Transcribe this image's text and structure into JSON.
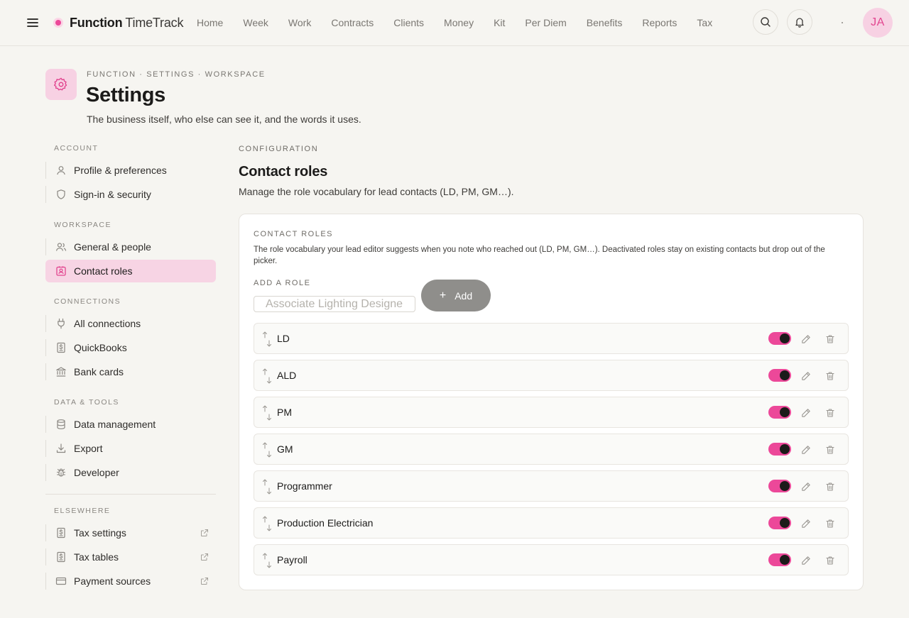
{
  "app": {
    "brand_name": "Function",
    "brand_sub": "TimeTrack",
    "nav": [
      "Home",
      "Week",
      "Work",
      "Contracts",
      "Clients",
      "Money",
      "Kit",
      "Per Diem",
      "Benefits",
      "Reports",
      "Tax"
    ],
    "user_initials": "JA",
    "accent_color": "#ec4899",
    "icons": {
      "menu": "hamburger-icon",
      "search": "search-icon",
      "notifications": "bell-icon"
    }
  },
  "header": {
    "breadcrumb": "FUNCTION · SETTINGS · WORKSPACE",
    "title": "Settings",
    "subtitle": "The business itself, who else can see it, and the words it uses.",
    "icon": "gear-icon"
  },
  "sidebar": {
    "groups": [
      {
        "label": "ACCOUNT",
        "items": [
          {
            "label": "Profile & preferences",
            "icon": "user-icon"
          },
          {
            "label": "Sign-in & security",
            "icon": "shield-icon"
          }
        ]
      },
      {
        "label": "WORKSPACE",
        "items": [
          {
            "label": "General & people",
            "icon": "users-icon"
          },
          {
            "label": "Contact roles",
            "icon": "contact-card-icon",
            "active": true
          }
        ]
      },
      {
        "label": "CONNECTIONS",
        "items": [
          {
            "label": "All connections",
            "icon": "plug-icon"
          },
          {
            "label": "QuickBooks",
            "icon": "dollar-doc-icon"
          },
          {
            "label": "Bank cards",
            "icon": "bank-icon"
          }
        ]
      },
      {
        "label": "DATA & TOOLS",
        "items": [
          {
            "label": "Data management",
            "icon": "database-icon"
          },
          {
            "label": "Export",
            "icon": "download-icon"
          },
          {
            "label": "Developer",
            "icon": "bug-icon"
          }
        ]
      },
      {
        "label": "ELSEWHERE",
        "items": [
          {
            "label": "Tax settings",
            "icon": "dollar-doc-icon",
            "external": true
          },
          {
            "label": "Tax tables",
            "icon": "dollar-doc-icon",
            "external": true
          },
          {
            "label": "Payment sources",
            "icon": "credit-card-icon",
            "external": true
          }
        ]
      }
    ]
  },
  "main": {
    "eyebrow": "CONFIGURATION",
    "title": "Contact roles",
    "description": "Manage the role vocabulary for lead contacts (LD, PM, GM…)."
  },
  "card": {
    "eyebrow": "CONTACT ROLES",
    "description": "The role vocabulary your lead editor suggests when you note who reached out (LD, PM, GM…). Deactivated roles stay on existing contacts but drop out of the picker.",
    "add_label": "ADD A ROLE",
    "add_placeholder": "Associate Lighting Designer",
    "add_value": "",
    "add_button": "Add",
    "roles": [
      {
        "name": "LD",
        "active": true
      },
      {
        "name": "ALD",
        "active": true
      },
      {
        "name": "PM",
        "active": true
      },
      {
        "name": "GM",
        "active": true
      },
      {
        "name": "Programmer",
        "active": true
      },
      {
        "name": "Production Electrician",
        "active": true
      },
      {
        "name": "Payroll",
        "active": true
      }
    ]
  }
}
